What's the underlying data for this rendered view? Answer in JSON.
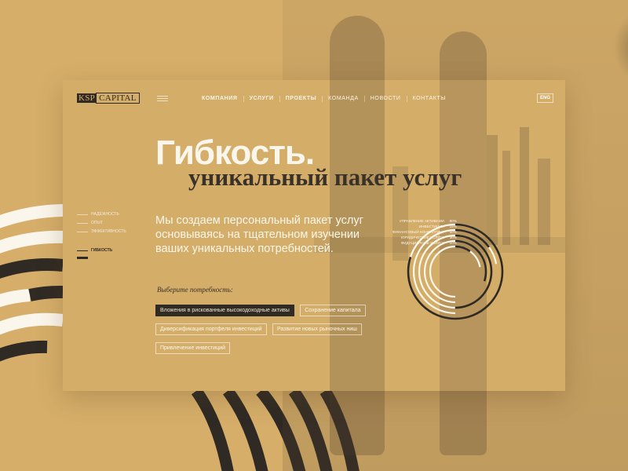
{
  "brand": {
    "part1": "KSP",
    "part2": "CAPITAL"
  },
  "nav": {
    "items": [
      {
        "label": "КОМПАНИЯ",
        "bold": true
      },
      {
        "label": "УСЛУГИ",
        "bold": true
      },
      {
        "label": "ПРОЕКТЫ",
        "bold": true
      },
      {
        "label": "КОМАНДА",
        "bold": false
      },
      {
        "label": "НОВОСТИ",
        "bold": false
      },
      {
        "label": "КОНТАКТЫ",
        "bold": false
      }
    ],
    "language": "ENG"
  },
  "hero": {
    "title": "Гибкость.",
    "subtitle": "уникальный пакет услуг",
    "lead": "Мы создаем персональный пакет услуг основываясь на тщательном изучении ваших уникальных потребностей.",
    "choose_label": "Выберите потребность:"
  },
  "side_nav": {
    "items": [
      "НАДЕЖНОСТЬ",
      "ОПЫТ",
      "ЭФФЕКТИВНОСТЬ"
    ],
    "active": "ГИБКОСТЬ"
  },
  "tags": [
    {
      "label": "Вложения в рискованные высокодоходные активы",
      "active": true
    },
    {
      "label": "Сохранение капитала",
      "active": false
    },
    {
      "label": "Диверсификация портфеля инвестиций",
      "active": false
    },
    {
      "label": "Развитие новых рыночных ниш",
      "active": false
    },
    {
      "label": "Привлечение инвестиций",
      "active": false
    }
  ],
  "colors": {
    "background": "#d6ae6a",
    "card": "#d4ad69",
    "dark": "#2f2a24",
    "light": "#fbf6ec"
  },
  "chart_data": {
    "type": "radial-bar",
    "series": [
      {
        "name": "УПРАВЛЕНИЕ АКТИВАМИ",
        "value": 80,
        "label": "80%"
      },
      {
        "name": "ИНВЕСТИЦИИ",
        "value": 15,
        "label": "15%"
      },
      {
        "name": "ФИНАНСОВЫЙ КОНСАЛТИНГ",
        "value": 50,
        "label": "50%"
      },
      {
        "name": "ЮРИДИЧЕСКИЕ УСЛУГИ",
        "value": 30,
        "label": "30%"
      },
      {
        "name": "ФИДУЦИАРНЫЕ УСЛУГИ",
        "value": 10,
        "label": "10%"
      }
    ]
  }
}
